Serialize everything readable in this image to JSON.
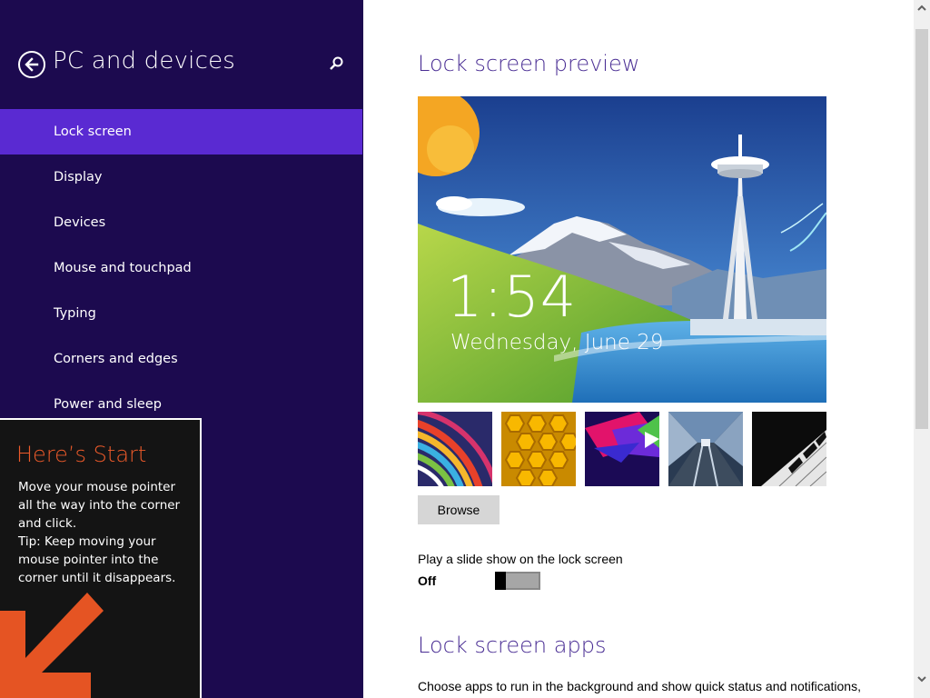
{
  "sidebar": {
    "title": "PC and devices",
    "back_icon": "back-arrow-icon",
    "search_icon": "search-icon",
    "items": [
      {
        "label": "Lock screen",
        "selected": true
      },
      {
        "label": "Display",
        "selected": false
      },
      {
        "label": "Devices",
        "selected": false
      },
      {
        "label": "Mouse and touchpad",
        "selected": false
      },
      {
        "label": "Typing",
        "selected": false
      },
      {
        "label": "Corners and edges",
        "selected": false
      },
      {
        "label": "Power and sleep",
        "selected": false
      }
    ]
  },
  "tip": {
    "title": "Here’s Start",
    "lines": [
      "Move your mouse pointer",
      "all the way into the corner",
      "and click.",
      "Tip: Keep moving your",
      "mouse pointer into the",
      "corner until it disappears."
    ],
    "arrow_icon": "arrow-down-left-icon"
  },
  "main": {
    "preview_title": "Lock screen preview",
    "preview_time": "1:54",
    "preview_date": "Wednesday, June 29",
    "thumbnails": [
      "colorful-stripes",
      "honeycomb",
      "geometric-shapes",
      "train-tunnel",
      "piano-keys"
    ],
    "browse_label": "Browse",
    "slideshow_label": "Play a slide show on the lock screen",
    "slideshow_state": "Off",
    "apps_title": "Lock screen apps",
    "apps_description": "Choose apps to run in the background and show quick status and notifications,"
  },
  "colors": {
    "sidebar_bg": "#1c0a4f",
    "selected_bg": "#5a2ad2",
    "accent_title": "#4a2e94",
    "tip_title": "#ec5a2a",
    "tip_arrow": "#e55423"
  }
}
